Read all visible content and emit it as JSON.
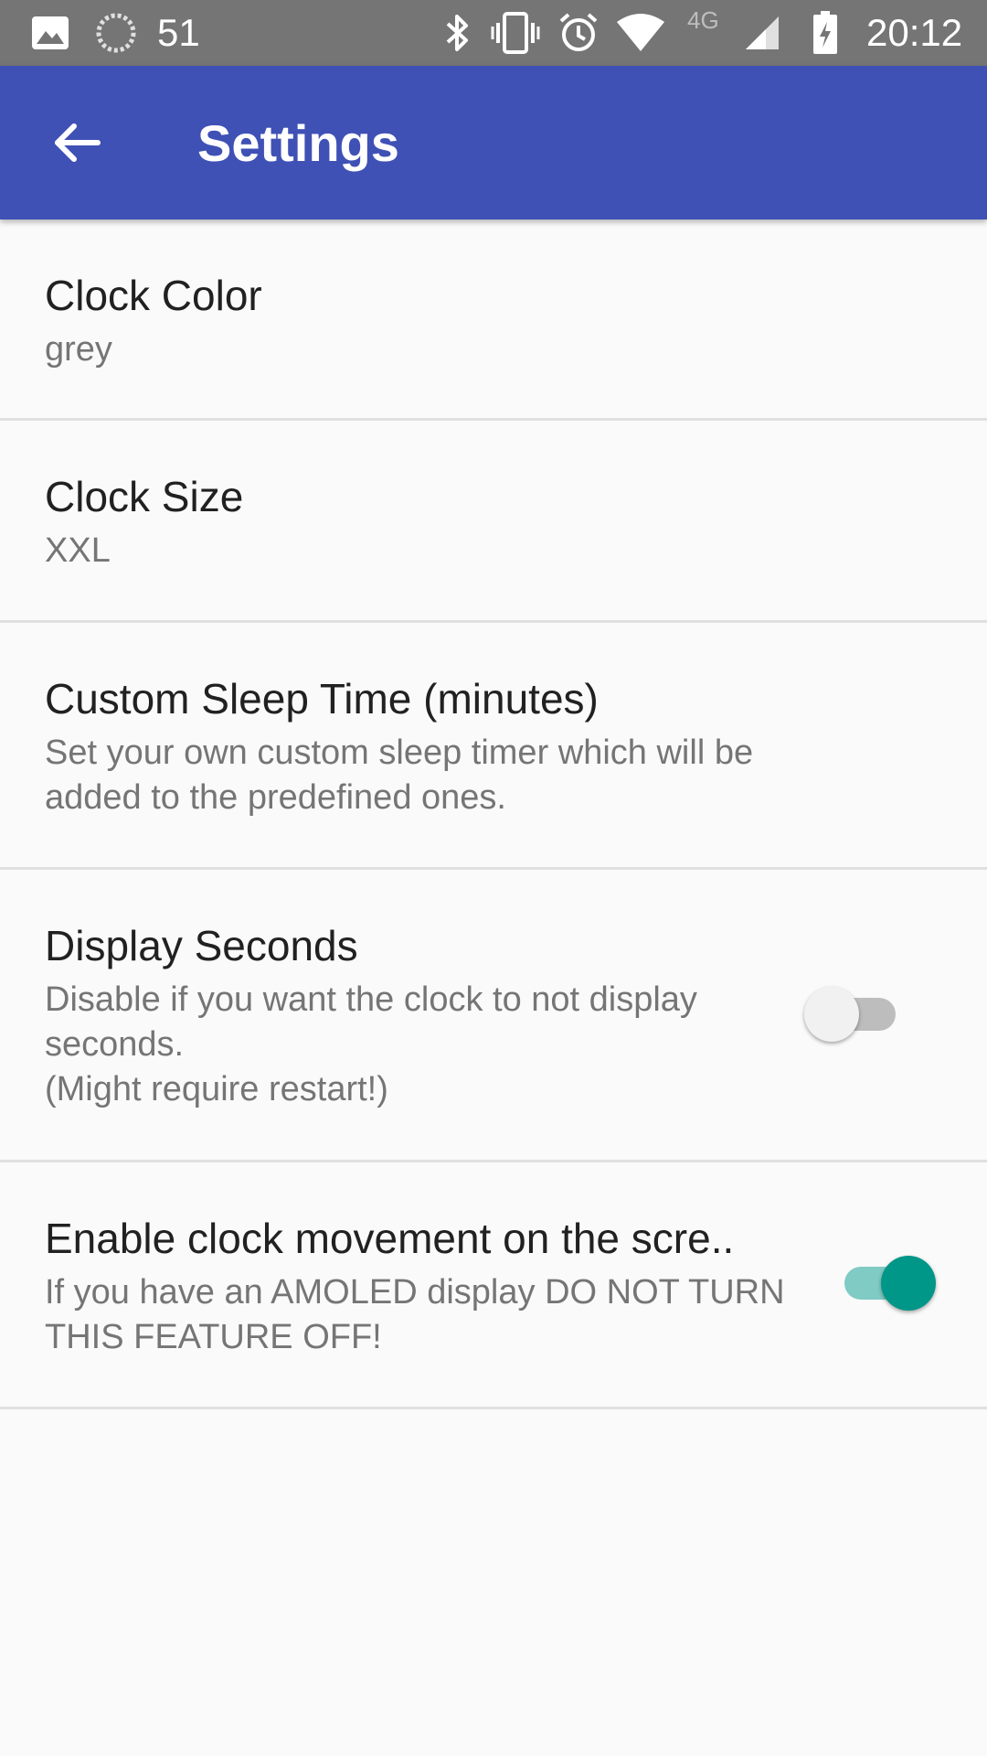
{
  "status_bar": {
    "notification_count": "51",
    "network_type": "4G",
    "time": "20:12",
    "icons": [
      "image-icon",
      "sync-icon",
      "bluetooth-icon",
      "vibrate-icon",
      "alarm-icon",
      "wifi-icon",
      "signal-icon",
      "battery-icon"
    ]
  },
  "app_bar": {
    "title": "Settings",
    "back_icon": "arrow-back-icon",
    "color": "#3f51b5"
  },
  "preferences": [
    {
      "title": "Clock Color",
      "summary": "grey"
    },
    {
      "title": "Clock Size",
      "summary": "XXL"
    },
    {
      "title": "Custom Sleep Time (minutes)",
      "summary": "Set your own custom sleep timer which will be added to the predefined ones."
    },
    {
      "title": "Display Seconds",
      "summary": "Disable if you want the clock to not display seconds.",
      "summary_note": "(Might require restart!)",
      "switch_on": false
    },
    {
      "title": "Enable clock movement on the scre..",
      "summary": "If you have an AMOLED display DO NOT TURN THIS FEATURE OFF!",
      "switch_on": true
    }
  ],
  "colors": {
    "accent": "#009688",
    "status_bar": "#757575",
    "background": "#fafafa"
  }
}
